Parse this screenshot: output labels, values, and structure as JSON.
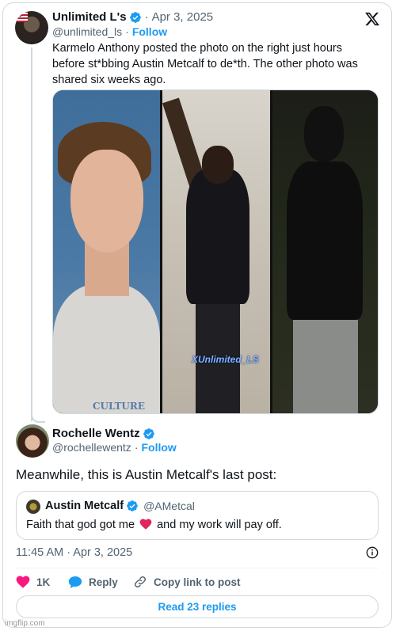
{
  "tweet1": {
    "display_name": "Unlimited L's",
    "handle": "@unlimited_ls",
    "date": "Apr 3, 2025",
    "follow_label": "Follow",
    "text": "Karmelo Anthony posted the photo on the right just hours before st*bbing Austin Metcalf to de*th. The other photo was shared six weeks ago.",
    "media": {
      "watermark": "XUnlimited_LS",
      "shirt_text": "CULTURE"
    }
  },
  "tweet2": {
    "display_name": "Rochelle Wentz",
    "handle": "@rochellewentz",
    "follow_label": "Follow",
    "text": "Meanwhile, this is Austin Metcalf's last post:",
    "quoted": {
      "display_name": "Austin Metcalf",
      "handle": "@AMetcal",
      "text_before": "Faith that god got me",
      "text_after": "and my work will pay off."
    },
    "timestamp": "11:45 AM · Apr 3, 2025",
    "actions": {
      "likes": "1K",
      "reply_label": "Reply",
      "copy_label": "Copy link to post"
    },
    "read_replies_label": "Read 23 replies"
  },
  "footer": {
    "imgflip": "imgflip.com"
  },
  "icons": {
    "verified": "verified-badge-icon",
    "x_logo": "x-logo-icon",
    "heart": "heart-icon",
    "reply": "reply-bubble-icon",
    "link": "link-icon",
    "info": "info-icon"
  },
  "colors": {
    "accent": "#1d9bf0",
    "like": "#f91880",
    "muted": "#536471"
  }
}
